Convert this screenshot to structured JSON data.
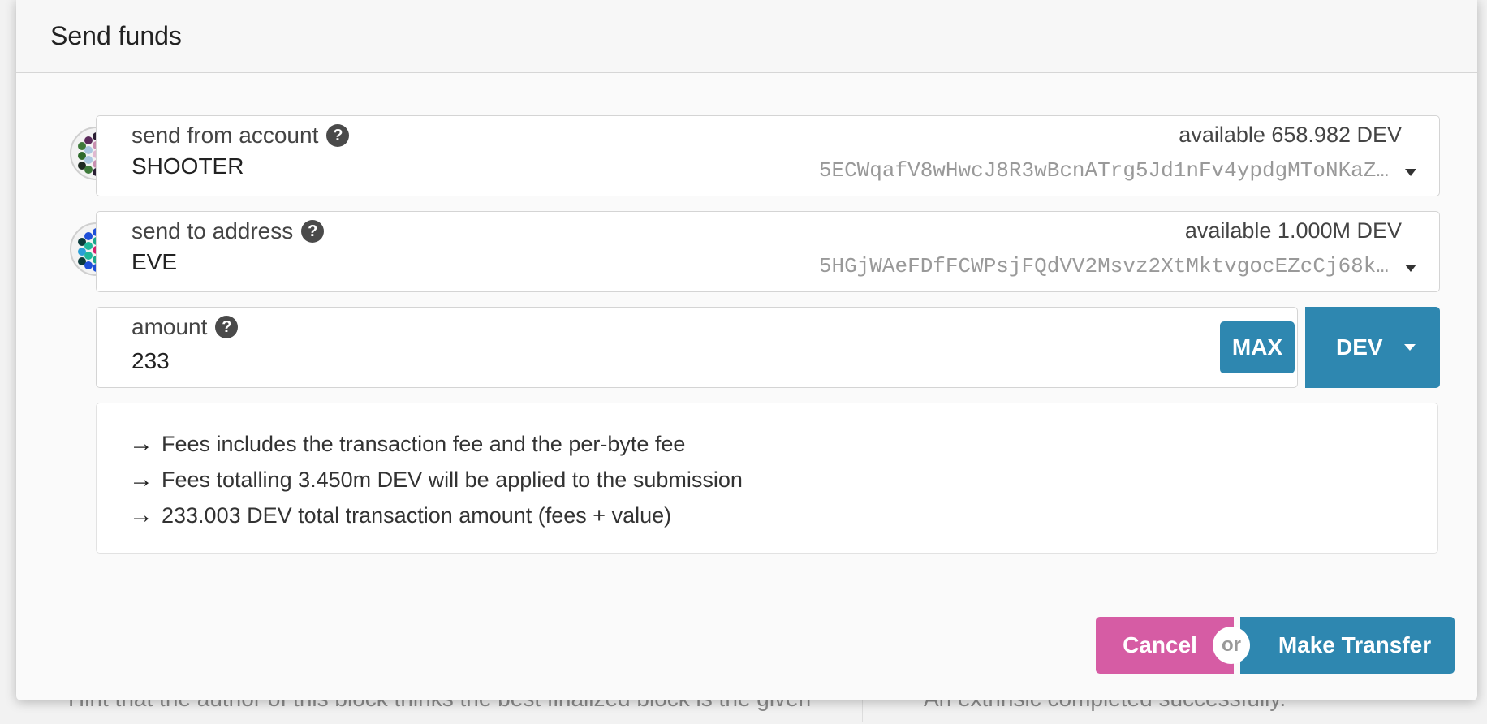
{
  "modal": {
    "title": "Send funds"
  },
  "from": {
    "label": "send from account",
    "name": "SHOOTER",
    "available": "available 658.982 DEV",
    "address": "5ECWqafV8wHwcJ8R3wBcnATrg5Jd1nFv4ypdgMToNKaZ…"
  },
  "to": {
    "label": "send to address",
    "name": "EVE",
    "available": "available 1.000M DEV",
    "address": "5HGjWAeFDfFCWPsjFQdVV2Msvz2XtMktvgocEZcCj68k…"
  },
  "amount": {
    "label": "amount",
    "value": "233",
    "max_label": "MAX",
    "unit": "DEV"
  },
  "info": {
    "lines": [
      "Fees includes the transaction fee and the per-byte fee",
      "Fees totalling 3.450m DEV will be applied to the submission",
      "233.003 DEV total transaction amount (fees + value)"
    ]
  },
  "actions": {
    "cancel_label": "Cancel",
    "or_label": "or",
    "transfer_label": "Make Transfer"
  },
  "background": {
    "left_text": "Hint that the author of this block thinks the best finalized block is the given",
    "right_text": "An extrinsic completed successfully."
  },
  "colors": {
    "primary": "#2e87b0",
    "cancel": "#d65ca4"
  }
}
